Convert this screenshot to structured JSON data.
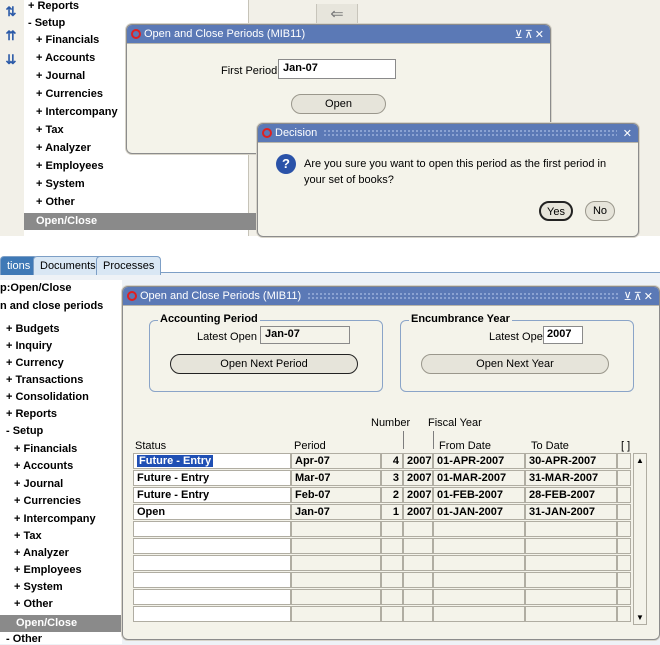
{
  "top": {
    "nav": {
      "items": [
        "+ Reports",
        "- Setup",
        "+ Financials",
        "+ Accounts",
        "+ Journal",
        "+ Currencies",
        "+ Intercompany",
        "+ Tax",
        "+ Analyzer",
        "+ Employees",
        "+ System",
        "+ Other"
      ],
      "selected": "Open/Close"
    },
    "window": {
      "title": "Open and Close Periods (MIB11)",
      "first_period_label": "First Period",
      "first_period_value": "Jan-07",
      "open_button": "Open"
    },
    "decision": {
      "title": "Decision",
      "message": "Are you sure you want to open this period as the first period in your set of books?",
      "yes_button": "Yes",
      "no_button": "No"
    }
  },
  "bottom": {
    "tabs": [
      "tions",
      "Documents",
      "Processes"
    ],
    "nav": {
      "header1": "p:Open/Close",
      "header2": "n and close periods",
      "items": [
        "+ Budgets",
        "+ Inquiry",
        "+ Currency",
        "+ Transactions",
        "+ Consolidation",
        "+ Reports",
        "- Setup",
        "+ Financials",
        "+ Accounts",
        "+ Journal",
        "+ Currencies",
        "+ Intercompany",
        "+ Tax",
        "+ Analyzer",
        "+ Employees",
        "+ System",
        "+ Other"
      ],
      "selected": "Open/Close",
      "last": "- Other"
    },
    "window": {
      "title": "Open and Close Periods (MIB11)",
      "accounting": {
        "title": "Accounting Period",
        "latest_open_label": "Latest Open",
        "latest_open_value": "Jan-07",
        "button": "Open Next Period"
      },
      "encumbrance": {
        "title": "Encumbrance Year",
        "latest_open_label": "Latest Open",
        "latest_open_value": "2007",
        "button": "Open Next Year"
      },
      "table": {
        "group_headers": [
          "Number",
          "Fiscal Year"
        ],
        "columns": [
          "Status",
          "Period",
          "",
          "",
          "From Date",
          "To Date",
          "[ ]"
        ],
        "rows": [
          {
            "status": "Future - Entry",
            "period": "Apr-07",
            "number": "4",
            "year": "2007",
            "from": "01-APR-2007",
            "to": "30-APR-2007"
          },
          {
            "status": "Future - Entry",
            "period": "Mar-07",
            "number": "3",
            "year": "2007",
            "from": "01-MAR-2007",
            "to": "31-MAR-2007"
          },
          {
            "status": "Future - Entry",
            "period": "Feb-07",
            "number": "2",
            "year": "2007",
            "from": "01-FEB-2007",
            "to": "28-FEB-2007"
          },
          {
            "status": "Open",
            "period": "Jan-07",
            "number": "1",
            "year": "2007",
            "from": "01-JAN-2007",
            "to": "31-JAN-2007"
          },
          {
            "status": "",
            "period": "",
            "number": "",
            "year": "",
            "from": "",
            "to": ""
          },
          {
            "status": "",
            "period": "",
            "number": "",
            "year": "",
            "from": "",
            "to": ""
          },
          {
            "status": "",
            "period": "",
            "number": "",
            "year": "",
            "from": "",
            "to": ""
          },
          {
            "status": "",
            "period": "",
            "number": "",
            "year": "",
            "from": "",
            "to": ""
          },
          {
            "status": "",
            "period": "",
            "number": "",
            "year": "",
            "from": "",
            "to": ""
          },
          {
            "status": "",
            "period": "",
            "number": "",
            "year": "",
            "from": "",
            "to": ""
          }
        ]
      }
    }
  }
}
